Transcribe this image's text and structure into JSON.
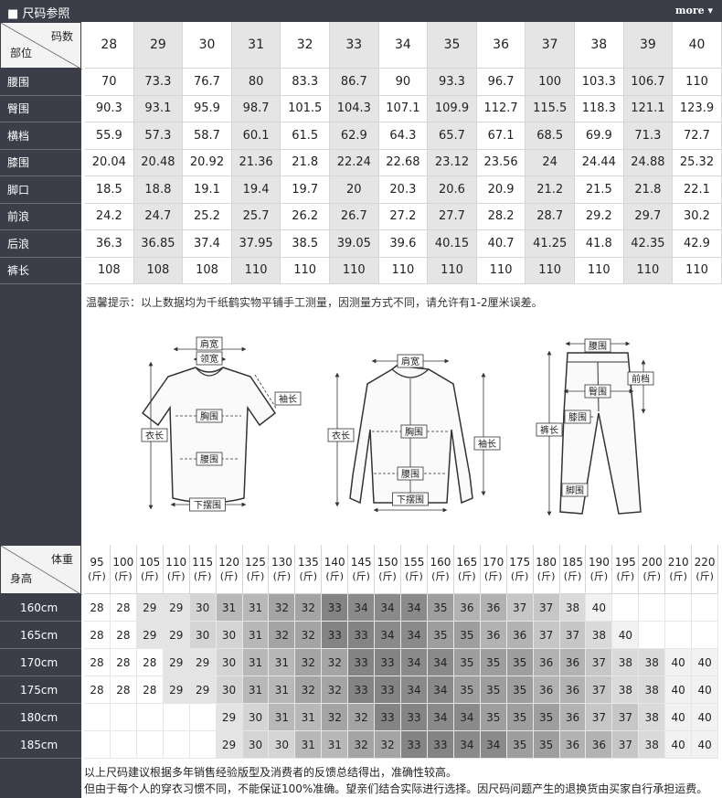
{
  "header": {
    "title": "尺码参照",
    "more": "more"
  },
  "size_table": {
    "corner_top": "码数",
    "corner_bottom": "部位",
    "sizes": [
      "28",
      "29",
      "30",
      "31",
      "32",
      "33",
      "34",
      "35",
      "36",
      "37",
      "38",
      "39",
      "40"
    ],
    "rows": [
      {
        "label": "腰围",
        "values": [
          "70",
          "73.3",
          "76.7",
          "80",
          "83.3",
          "86.7",
          "90",
          "93.3",
          "96.7",
          "100",
          "103.3",
          "106.7",
          "110"
        ]
      },
      {
        "label": "臀围",
        "values": [
          "90.3",
          "93.1",
          "95.9",
          "98.7",
          "101.5",
          "104.3",
          "107.1",
          "109.9",
          "112.7",
          "115.5",
          "118.3",
          "121.1",
          "123.9"
        ]
      },
      {
        "label": "横档",
        "values": [
          "55.9",
          "57.3",
          "58.7",
          "60.1",
          "61.5",
          "62.9",
          "64.3",
          "65.7",
          "67.1",
          "68.5",
          "69.9",
          "71.3",
          "72.7"
        ]
      },
      {
        "label": "膝围",
        "values": [
          "20.04",
          "20.48",
          "20.92",
          "21.36",
          "21.8",
          "22.24",
          "22.68",
          "23.12",
          "23.56",
          "24",
          "24.44",
          "24.88",
          "25.32"
        ]
      },
      {
        "label": "脚口",
        "values": [
          "18.5",
          "18.8",
          "19.1",
          "19.4",
          "19.7",
          "20",
          "20.3",
          "20.6",
          "20.9",
          "21.2",
          "21.5",
          "21.8",
          "22.1"
        ]
      },
      {
        "label": "前浪",
        "values": [
          "24.2",
          "24.7",
          "25.2",
          "25.7",
          "26.2",
          "26.7",
          "27.2",
          "27.7",
          "28.2",
          "28.7",
          "29.2",
          "29.7",
          "30.2"
        ]
      },
      {
        "label": "后浪",
        "values": [
          "36.3",
          "36.85",
          "37.4",
          "37.95",
          "38.5",
          "39.05",
          "39.6",
          "40.15",
          "40.7",
          "41.25",
          "41.8",
          "42.35",
          "42.9"
        ]
      },
      {
        "label": "裤长",
        "values": [
          "108",
          "108",
          "108",
          "110",
          "110",
          "110",
          "110",
          "110",
          "110",
          "110",
          "110",
          "110",
          "110"
        ]
      }
    ],
    "note": "温馨提示：以上数据均为千纸鹤实物平铺手工测量，因测量方式不同，请允许有1-2厘米误差。"
  },
  "diagram_labels": {
    "tshirt": [
      "肩宽",
      "领宽",
      "袖长",
      "胸围",
      "衣长",
      "腰围",
      "下摆围"
    ],
    "shirt": [
      "肩宽",
      "胸围",
      "衣长",
      "袖长",
      "腰围",
      "下摆围"
    ],
    "pants": [
      "腰围",
      "前档",
      "臀围",
      "裤长",
      "膝围",
      "脚围"
    ]
  },
  "weight_table": {
    "corner_top": "体重",
    "corner_bottom": "身高",
    "unit": "(斤)",
    "weights": [
      "95",
      "100",
      "105",
      "110",
      "115",
      "120",
      "125",
      "130",
      "135",
      "140",
      "145",
      "150",
      "155",
      "160",
      "165",
      "170",
      "175",
      "180",
      "185",
      "190",
      "195",
      "200",
      "210",
      "220"
    ],
    "heights": [
      {
        "label": "160cm",
        "values": [
          "28",
          "28",
          "29",
          "29",
          "30",
          "31",
          "31",
          "32",
          "32",
          "33",
          "34",
          "34",
          "34",
          "35",
          "36",
          "36",
          "37",
          "37",
          "38",
          "40",
          "",
          "",
          "",
          ""
        ]
      },
      {
        "label": "165cm",
        "values": [
          "28",
          "28",
          "29",
          "29",
          "30",
          "30",
          "31",
          "32",
          "32",
          "33",
          "33",
          "34",
          "34",
          "35",
          "35",
          "36",
          "36",
          "37",
          "37",
          "38",
          "40",
          "",
          "",
          ""
        ]
      },
      {
        "label": "170cm",
        "values": [
          "28",
          "28",
          "28",
          "29",
          "29",
          "30",
          "31",
          "31",
          "32",
          "32",
          "33",
          "33",
          "34",
          "34",
          "35",
          "35",
          "35",
          "36",
          "36",
          "37",
          "38",
          "38",
          "40",
          "40"
        ]
      },
      {
        "label": "175cm",
        "values": [
          "28",
          "28",
          "28",
          "29",
          "29",
          "30",
          "31",
          "31",
          "32",
          "32",
          "33",
          "33",
          "34",
          "34",
          "35",
          "35",
          "35",
          "36",
          "36",
          "37",
          "38",
          "38",
          "40",
          "40"
        ]
      },
      {
        "label": "180cm",
        "values": [
          "",
          "",
          "",
          "",
          "",
          "29",
          "30",
          "31",
          "31",
          "32",
          "32",
          "33",
          "33",
          "34",
          "34",
          "35",
          "35",
          "35",
          "36",
          "37",
          "37",
          "38",
          "40",
          "40"
        ]
      },
      {
        "label": "185cm",
        "values": [
          "",
          "",
          "",
          "",
          "",
          "29",
          "30",
          "30",
          "31",
          "31",
          "32",
          "32",
          "33",
          "33",
          "34",
          "34",
          "35",
          "35",
          "36",
          "36",
          "37",
          "38",
          "40",
          "40"
        ]
      }
    ]
  },
  "footer": [
    "以上尺码建议根据多年销售经验版型及消费者的反馈总结得出，准确性较高。",
    "但由于每个人的穿衣习惯不同，不能保证100%准确。望亲们结合实际进行选择。因尺码问题产生的退换货由买家自行承担运费。"
  ],
  "colors": {
    "dark": "#3b3e49",
    "size_alt_column": "#e5e5e5",
    "size_map": {
      "28": "#ffffff",
      "29": "#e4e4e4",
      "30": "#d4d4d4",
      "31": "#b8b8b8",
      "32": "#a4a4a4",
      "33": "#848484",
      "34": "#8a8a8a",
      "35": "#9e9e9e",
      "36": "#b2b2b2",
      "37": "#c6c6c6",
      "38": "#dadada",
      "40": "#f2f2f2"
    }
  }
}
